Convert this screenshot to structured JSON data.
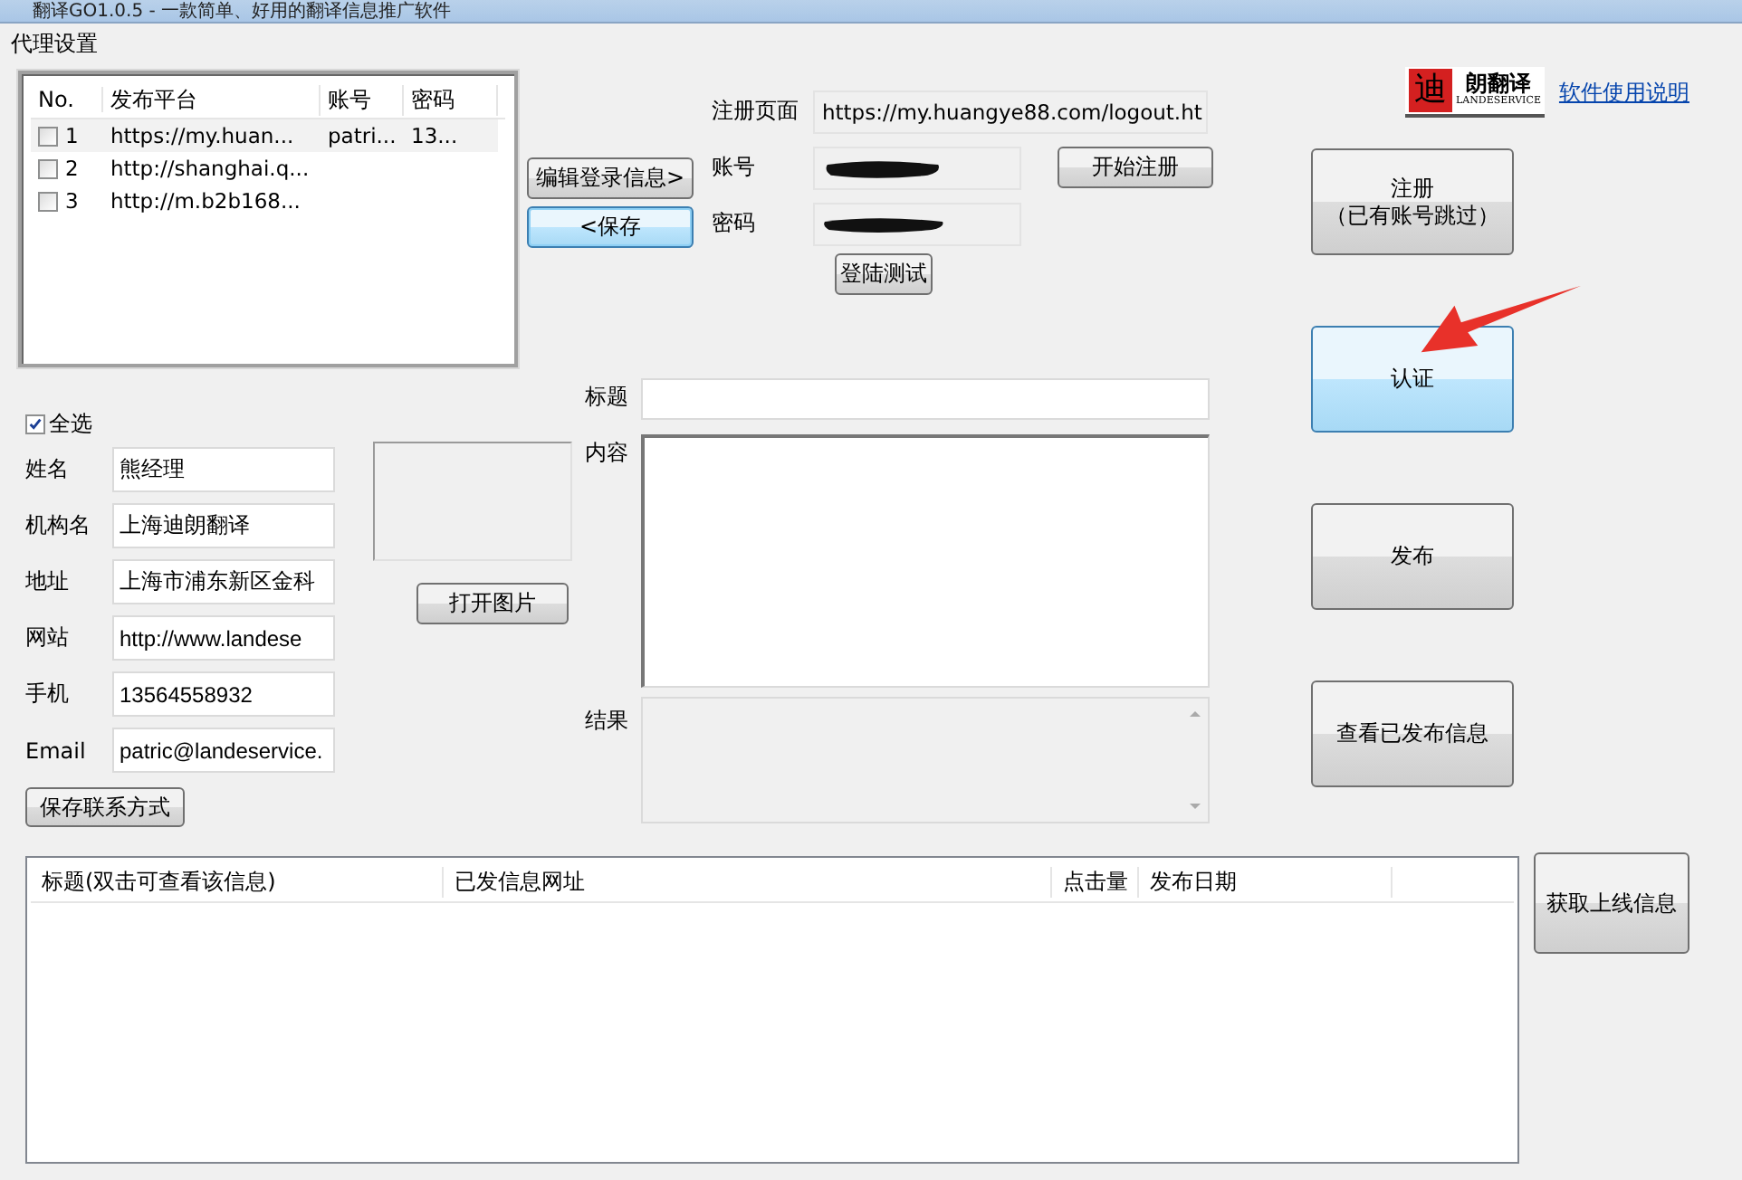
{
  "window": {
    "title": "翻译GO1.0.5 - 一款简单、好用的翻译信息推广软件"
  },
  "menu": [
    "代理设置"
  ],
  "platforms": {
    "columns": [
      "No.",
      "发布平台",
      "账号",
      "密码"
    ],
    "rows": [
      {
        "no": "1",
        "platform": "https://my.huan...",
        "account": "patri...",
        "password": "13...",
        "checked": false,
        "selected": true
      },
      {
        "no": "2",
        "platform": "http://shanghai.q...",
        "checked": false,
        "selected": false
      },
      {
        "no": "3",
        "platform": "http://m.b2b168...",
        "checked": false,
        "selected": false
      }
    ]
  },
  "login_buttons": [
    {
      "label": "编辑登录信息>",
      "focused": false
    },
    {
      "label": "<保存",
      "focused": true
    }
  ],
  "login": {
    "register_page_label": "注册页面",
    "register_page": "https://my.huangye88.com/logout.ht",
    "account_label": "账号",
    "account_redacted": true,
    "password_label": "密码",
    "password_redacted": true,
    "register_button": "开始注册",
    "test_button": "登陆测试"
  },
  "select_all": {
    "label": "全选",
    "checked": true
  },
  "contact": {
    "fields": [
      {
        "label": "姓名",
        "value": "熊经理"
      },
      {
        "label": "机构名",
        "value": "上海迪朗翻译"
      },
      {
        "label": "地址",
        "value": "上海市浦东新区金科"
      },
      {
        "label": "网站",
        "value": "http://www.landese"
      },
      {
        "label": "手机",
        "value": "13564558932"
      },
      {
        "label": "Email",
        "value": "patric@landeservice."
      }
    ],
    "save_button": "保存联系方式"
  },
  "image": {
    "open_button": "打开图片"
  },
  "post": {
    "title_label": "标题",
    "content_label": "内容",
    "result_label": "结果"
  },
  "logo": {
    "mark": "迪",
    "name": "朗翻译",
    "tagline": "LANDESERVICE"
  },
  "help_link": "软件使用说明",
  "actions": [
    {
      "label": "注册",
      "sublabel": "（已有账号跳过）",
      "highlighted": false
    },
    {
      "label": "认证",
      "highlighted": true
    },
    {
      "label": "发布",
      "highlighted": false
    },
    {
      "label": "查看已发布信息",
      "highlighted": false
    }
  ],
  "published": {
    "columns": [
      "标题(双击可查看该信息)",
      "已发信息网址",
      "点击量",
      "发布日期"
    ]
  },
  "fetch_button": "获取上线信息"
}
